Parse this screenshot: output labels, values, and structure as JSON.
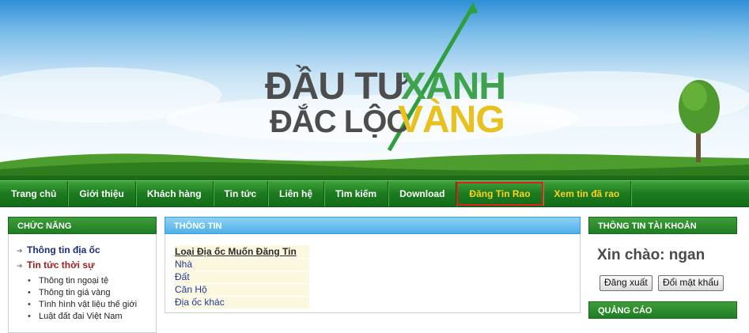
{
  "logo": {
    "line1_dark": "ĐẦU TƯ",
    "line1_green": "XANH",
    "line2_dark": "ĐẮC LỘC",
    "line2_gold": "VÀNG"
  },
  "nav": {
    "items": [
      {
        "label": "Trang chủ",
        "style": "normal"
      },
      {
        "label": "Giới thiệu",
        "style": "normal"
      },
      {
        "label": "Khách hàng",
        "style": "normal"
      },
      {
        "label": "Tin tức",
        "style": "normal"
      },
      {
        "label": "Liên hệ",
        "style": "normal"
      },
      {
        "label": "Tìm kiếm",
        "style": "normal"
      },
      {
        "label": "Download",
        "style": "normal"
      },
      {
        "label": "Đăng Tin Rao",
        "style": "highlight"
      },
      {
        "label": "Xem tin đã rao",
        "style": "gold"
      }
    ]
  },
  "left_panel": {
    "title": "CHỨC NĂNG",
    "main_links": [
      {
        "label": "Thông tin địa ốc"
      },
      {
        "label": "Tin tức thời sự"
      }
    ],
    "sub_items": [
      {
        "label": "Thông tin ngoại tệ"
      },
      {
        "label": "Thông tin giá vàng"
      },
      {
        "label": "Tình hình vật liệu thế giới"
      },
      {
        "label": "Luật đất đai Việt Nam"
      }
    ]
  },
  "center_panel": {
    "title": "THÔNG TIN",
    "table_title": "Loại Địa ốc Muốn Đăng Tin",
    "options": [
      {
        "label": "Nhà"
      },
      {
        "label": "Đất"
      },
      {
        "label": "Căn Hộ"
      },
      {
        "label": "Địa ốc khác"
      }
    ]
  },
  "right_panel": {
    "title": "THÔNG TIN TÀI KHOẢN",
    "greeting": "Xin chào: ngan",
    "logout_label": "Đăng xuất",
    "change_password_label": "Đổi mật khẩu",
    "ads_title": "QUẢNG CÁO"
  },
  "colors": {
    "nav_green": "#1c7a20",
    "highlight_border": "#e02020",
    "gold_text": "#ffd21a",
    "panel_blue": "#4fb1e8"
  }
}
